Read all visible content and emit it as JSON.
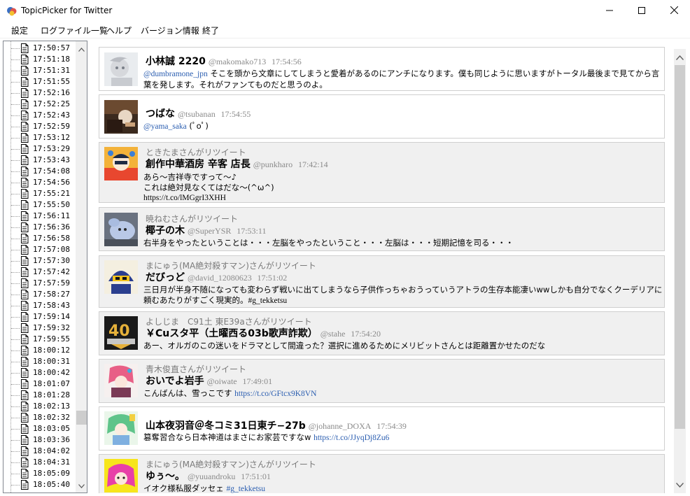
{
  "window": {
    "title": "TopicPicker for Twitter",
    "minimize_icon": "minimize-icon",
    "maximize_icon": "maximize-icon",
    "close_icon": "close-icon"
  },
  "menu": {
    "items": [
      "設定",
      "ログファイル一覧",
      "ヘルプ",
      "バージョン情報",
      "終了"
    ]
  },
  "tree": {
    "items": [
      "17:50:57",
      "17:51:18",
      "17:51:31",
      "17:51:55",
      "17:52:16",
      "17:52:25",
      "17:52:43",
      "17:52:59",
      "17:53:12",
      "17:53:29",
      "17:53:43",
      "17:54:08",
      "17:54:56",
      "17:55:21",
      "17:55:50",
      "17:56:11",
      "17:56:36",
      "17:56:58",
      "17:57:08",
      "17:57:30",
      "17:57:42",
      "17:57:59",
      "17:58:27",
      "17:58:43",
      "17:59:14",
      "17:59:32",
      "17:59:55",
      "18:00:12",
      "18:00:31",
      "18:00:42",
      "18:01:07",
      "18:01:28",
      "18:02:13",
      "18:02:32",
      "18:03:05",
      "18:03:36",
      "18:04:02",
      "18:04:31",
      "18:05:09",
      "18:05:40"
    ]
  },
  "tweets": [
    {
      "retweet_by": "",
      "name": "小林誠 2220",
      "handle": "@makomako713",
      "time": "17:54:56",
      "mention": "@dumbramone_jpn",
      "text": " そこを頭から文章にしてしまうと愛着があるのにアンチになります。僕も同じように思いますがトータル最後まで見てから言葉を発します。それがファンてものだと思うのよ。"
    },
    {
      "retweet_by": "",
      "name": "つばな",
      "handle": "@tsubanan",
      "time": "17:54:55",
      "mention": "@yama_saka",
      "text": " (ﾟoﾟ)"
    },
    {
      "retweet_by": "ときたまさんがリツイート",
      "name": "創作中華酒房 辛客 店長",
      "handle": "@punkharo",
      "time": "17:42:14",
      "text_line1": "あら～吉祥寺ですって～♪",
      "text_line2": "これは絶対見なくてはだな～(^ω^)",
      "text_line3": "https://t.co/lMGgrI3XHH"
    },
    {
      "retweet_by": "暁ねむさんがリツイート",
      "name": "椰子の木",
      "handle": "@SuperYSR",
      "time": "17:53:11",
      "text": "右半身をやったということは・・・左脳をやったということ・・・左脳は・・・短期記憶を司る・・・"
    },
    {
      "retweet_by": "まにゅう(MA絶対殺すマン)さんがリツイート",
      "name": "だびっど",
      "handle": "@david_12080623",
      "time": "17:51:02",
      "text": "三日月が半身不随になっても変わらず戦いに出てしまうなら子供作っちゃおうっていうアトラの生存本能凄いwwしかも自分でなくクーデリアに頼むあたりがすごく現実的。",
      "hashtag": "#g_tekketsu"
    },
    {
      "retweet_by": "よしじま　C91土 東E39aさんがリツイート",
      "name": "￥Cuスタ平（土曜西る03b歌声詐欺）",
      "handle": "@stahe",
      "time": "17:54:20",
      "text": "あー、オルガのこの迷いをドラマとして間違った？選択に進めるためにメリビットさんとは距離置かせたのだな"
    },
    {
      "retweet_by": "青木俊直さんがリツイート",
      "name": "おいでよ岩手",
      "handle": "@oiwate",
      "time": "17:49:01",
      "text": "こんばんは、雪っこです ",
      "link": "https://t.co/GFtcx9K8VN"
    },
    {
      "retweet_by": "",
      "name": "山本夜羽音＠冬コミ31日東チ−27b",
      "handle": "@johanne_DOXA",
      "time": "17:54:39",
      "text": "篡奪習合なら日本神道はまさにお家芸ですなw ",
      "link": "https://t.co/JJyqDj8Zu6"
    },
    {
      "retweet_by": "まにゅう(MA絶対殺すマン)さんがリツイート",
      "name": "ゆぅ〜。",
      "handle": "@yuuandroku",
      "time": "17:51:01",
      "text": "イオク様私服ダッセェ ",
      "hashtag": "#g_tekketsu"
    }
  ]
}
